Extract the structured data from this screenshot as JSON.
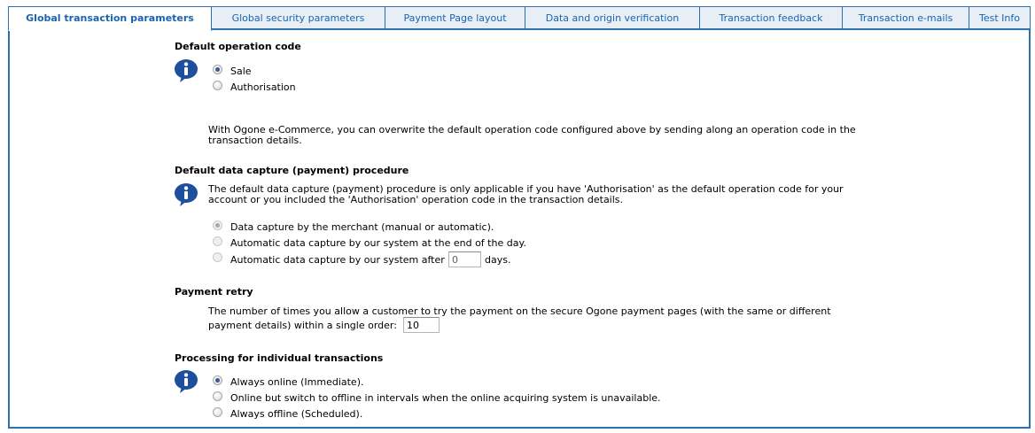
{
  "tabs": [
    "Global transaction parameters",
    "Global security parameters",
    "Payment Page layout",
    "Data and origin verification",
    "Transaction feedback",
    "Transaction e-mails",
    "Test Info"
  ],
  "section1": {
    "heading": "Default operation code",
    "options": [
      "Sale",
      "Authorisation"
    ],
    "note_line1": "With Ogone e-Commerce, you can overwrite the default operation code configured above by sending along an operation code in the",
    "note_line2": "transaction details."
  },
  "section2": {
    "heading": "Default data capture (payment) procedure",
    "info_line1": "The default data capture (payment) procedure is only applicable if you have 'Authorisation' as the default operation code for your",
    "info_line2": "account or you included the 'Authorisation' operation code in the transaction details.",
    "options": [
      "Data capture by the merchant (manual or automatic).",
      "Automatic data capture by our system at the end of the day.",
      "Automatic data capture by our system after"
    ],
    "days_value": "0",
    "days_suffix": "days."
  },
  "section3": {
    "heading": "Payment retry",
    "text_line1": "The number of times you allow a customer to try the payment on the secure Ogone payment pages (with the same or different",
    "text_line2": "payment details) within a single order:",
    "retry_value": "10"
  },
  "section4": {
    "heading": "Processing for individual transactions",
    "options": [
      "Always online (Immediate).",
      "Online but switch to offline in intervals when the online acquiring system is unavailable.",
      "Always offline (Scheduled)."
    ]
  },
  "colors": {
    "accent": "#2d70b0",
    "tab_bg": "#e8eef6",
    "tab_text": "#1a64b0"
  }
}
